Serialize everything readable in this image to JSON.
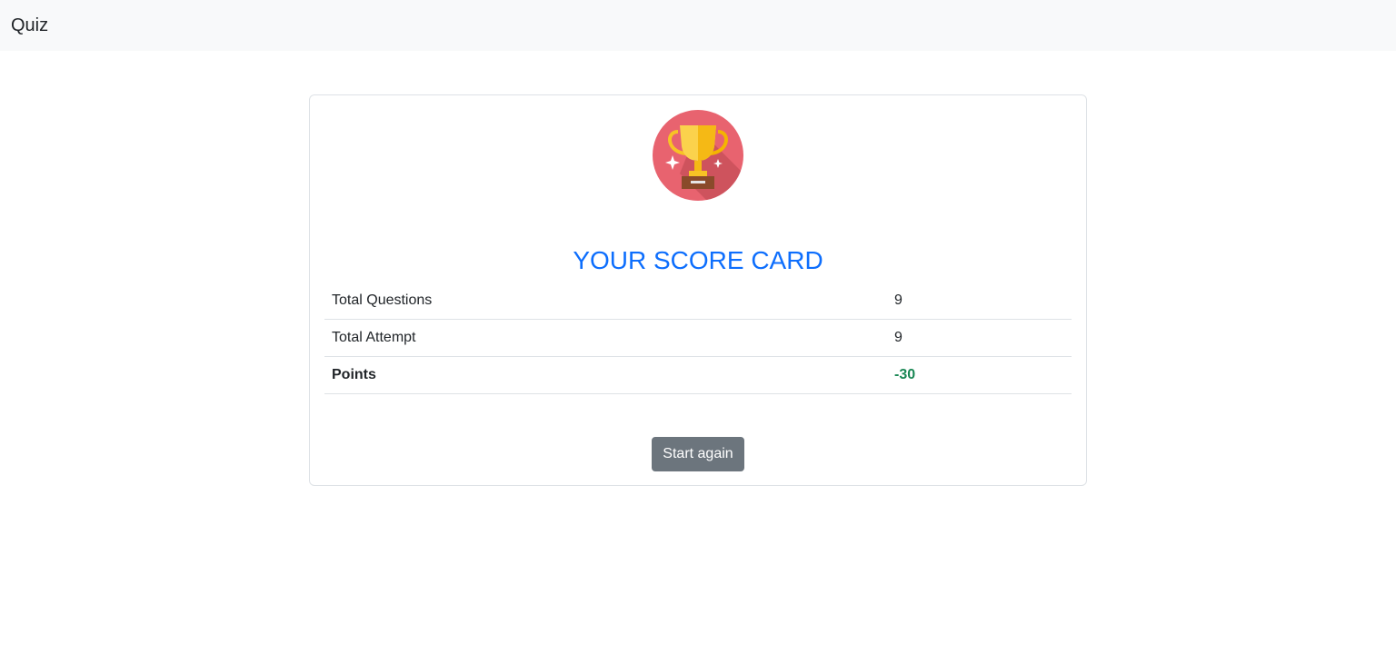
{
  "navbar": {
    "brand": "Quiz"
  },
  "card": {
    "icon": "trophy-icon",
    "title": "YOUR SCORE CARD",
    "rows": [
      {
        "label": "Total Questions",
        "value": "9"
      },
      {
        "label": "Total Attempt",
        "value": "9"
      },
      {
        "label": "Points",
        "value": "-30"
      }
    ],
    "button_label": "Start again"
  },
  "colors": {
    "title": "#0d6efd",
    "points": "#198754",
    "button": "#6c757d",
    "navbar_bg": "#f8f9fa",
    "trophy_circle": "#e0626b"
  }
}
